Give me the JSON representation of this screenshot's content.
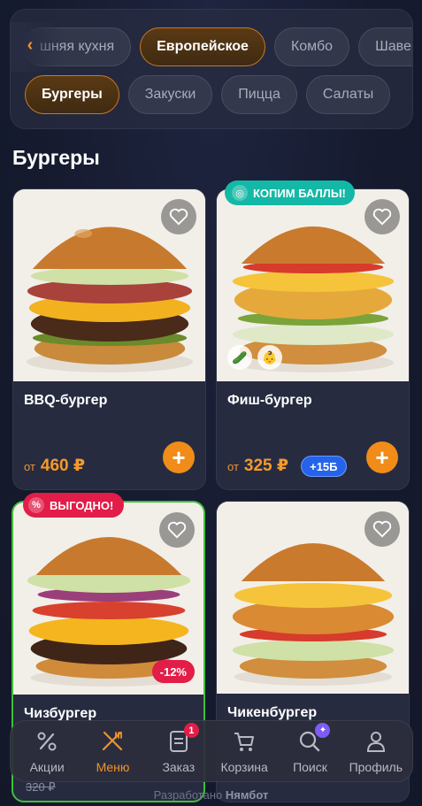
{
  "categories_row1": [
    "шняя кухня",
    "Европейское",
    "Комбо",
    "Шавер"
  ],
  "categories_row2": [
    "Бургеры",
    "Закуски",
    "Пицца",
    "Салаты"
  ],
  "active_category_row1": "Европейское",
  "active_category_row2": "Бургеры",
  "section_title": "Бургеры",
  "products": [
    {
      "name": "BBQ-бургер",
      "price_from": "от",
      "price": "460 ₽"
    },
    {
      "name": "Фиш-бургер",
      "price_from": "от",
      "price": "325 ₽",
      "bonus": "+15Б",
      "badge": "КОПИМ БАЛЛЫ!"
    },
    {
      "name": "Чизбургер",
      "old_price": "320 ₽",
      "badge": "ВЫГОДНО!",
      "discount": "-12%"
    },
    {
      "name": "Чикенбургер"
    }
  ],
  "nav": [
    {
      "label": "Акции",
      "icon": "percent-icon"
    },
    {
      "label": "Меню",
      "icon": "fork-knife-icon"
    },
    {
      "label": "Заказ",
      "icon": "receipt-icon",
      "badge": "1"
    },
    {
      "label": "Корзина",
      "icon": "cart-icon"
    },
    {
      "label": "Поиск",
      "icon": "search-icon"
    },
    {
      "label": "Профиль",
      "icon": "profile-icon"
    }
  ],
  "active_nav": "Меню",
  "footer": {
    "prefix": "Разработано",
    "brand": "Нямбот"
  },
  "colors": {
    "accent": "#f08c17",
    "background": "#151a2e",
    "card": "#272b40",
    "green_badge": "#14b8a6",
    "red_badge": "#e11d48",
    "bonus": "#2563eb"
  }
}
